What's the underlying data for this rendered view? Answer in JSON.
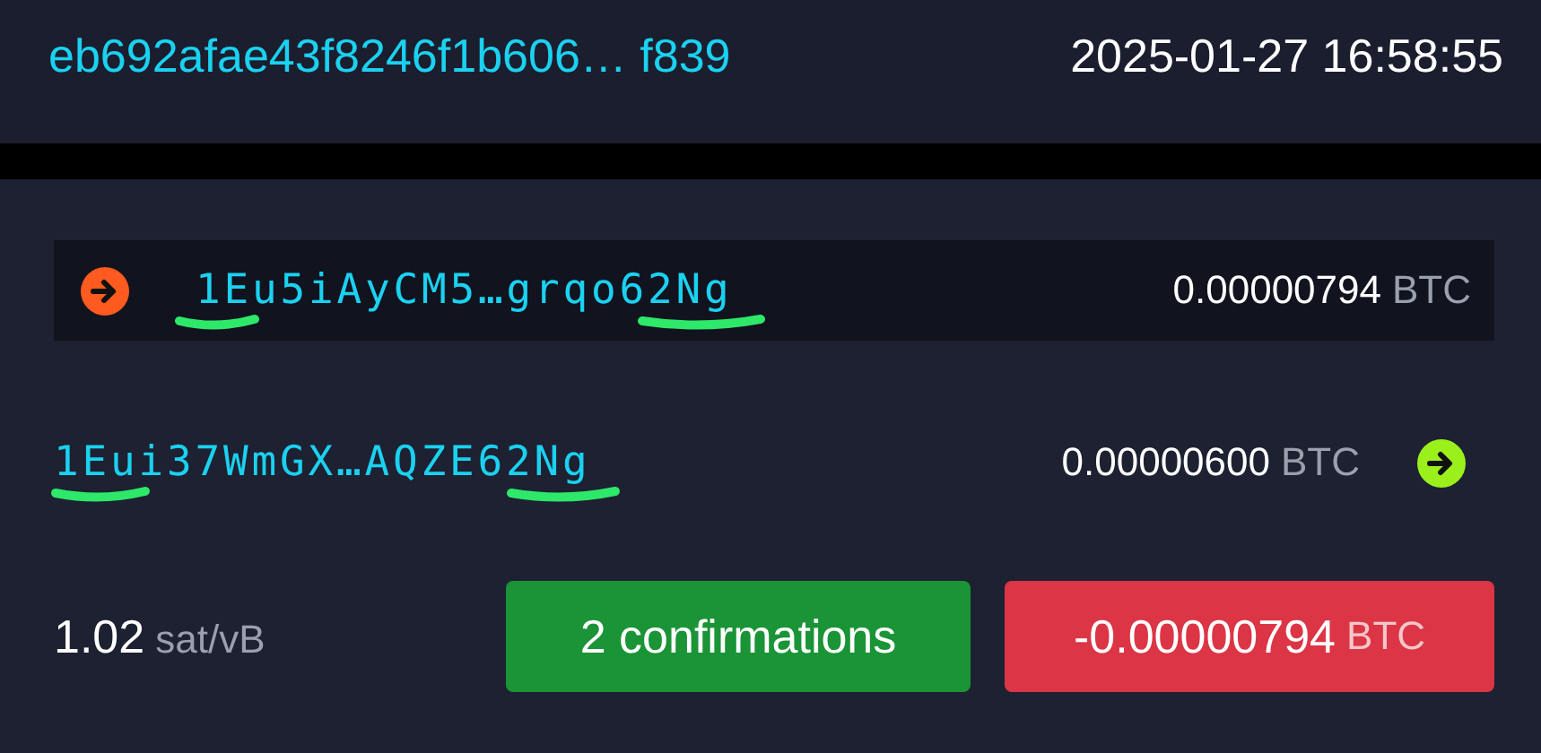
{
  "transaction": {
    "txid": "eb692afae43f8246f1b606… f839",
    "time": "2025-01-27 16:58:55"
  },
  "inputs": [
    {
      "address": "1Eu5iAyCM5…grqo62Ng",
      "amount": "0.00000794",
      "unit": "BTC"
    }
  ],
  "outputs": [
    {
      "address": "1Eui37WmGX…AQZE62Ng",
      "amount": "0.00000600",
      "unit": "BTC"
    }
  ],
  "footer": {
    "fee_rate": "1.02",
    "fee_unit": "sat/vB",
    "confirmations": "2 confirmations",
    "net_amount": "-0.00000794",
    "net_unit": "BTC"
  }
}
